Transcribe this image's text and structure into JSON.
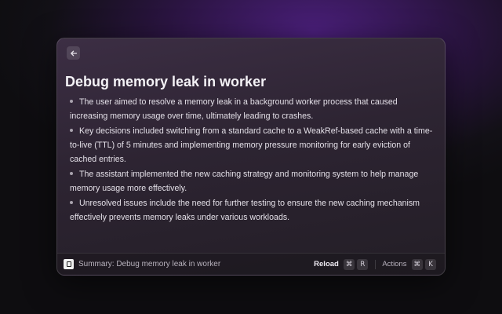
{
  "header": {
    "back_icon": "arrow-left-icon"
  },
  "main": {
    "title": "Debug memory leak in worker",
    "bullets": [
      "The user aimed to resolve a memory leak in a background worker process that caused increasing memory usage over time, ultimately leading to crashes.",
      "Key decisions included switching from a standard cache to a WeakRef-based cache with a time-to-live (TTL) of 5 minutes and implementing memory pressure monitoring for early eviction of cached entries.",
      "The assistant implemented the new caching strategy and monitoring system to help manage memory usage more effectively.",
      "Unresolved issues include the need for further testing to ensure the new caching mechanism effectively prevents memory leaks under various workloads."
    ]
  },
  "footer": {
    "command_title": "Summary: Debug memory leak in worker",
    "primary_action": {
      "label": "Reload",
      "keys": [
        "⌘",
        "R"
      ]
    },
    "actions_menu": {
      "label": "Actions",
      "keys": [
        "⌘",
        "K"
      ]
    }
  },
  "colors": {
    "accent_glow": "#4a1f7a",
    "window_bg": "#2d2432",
    "text": "#e4e0e8"
  }
}
